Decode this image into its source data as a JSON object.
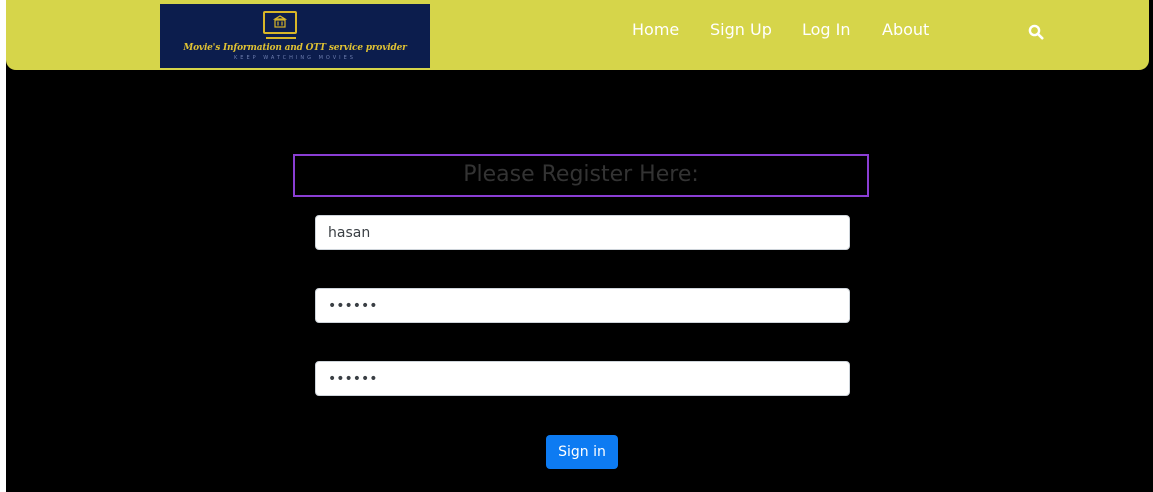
{
  "logo": {
    "title": "Movie's Information and OTT service provider",
    "tagline": "KEEP WATCHING MOVIES",
    "icon": "tv-icon"
  },
  "nav": {
    "items": [
      {
        "label": "Home"
      },
      {
        "label": "Sign Up"
      },
      {
        "label": "Log In"
      },
      {
        "label": "About"
      }
    ],
    "search_icon": "search-icon"
  },
  "form": {
    "heading": "Please Register Here:",
    "username_value": "hasan",
    "password_value": "••••••",
    "confirm_password_value": "••••••",
    "submit_label": "Sign in"
  },
  "colors": {
    "navbar": "#d6d54a",
    "background": "#000000",
    "heading_border": "#8a3ed3",
    "button": "#0d7bf2"
  }
}
